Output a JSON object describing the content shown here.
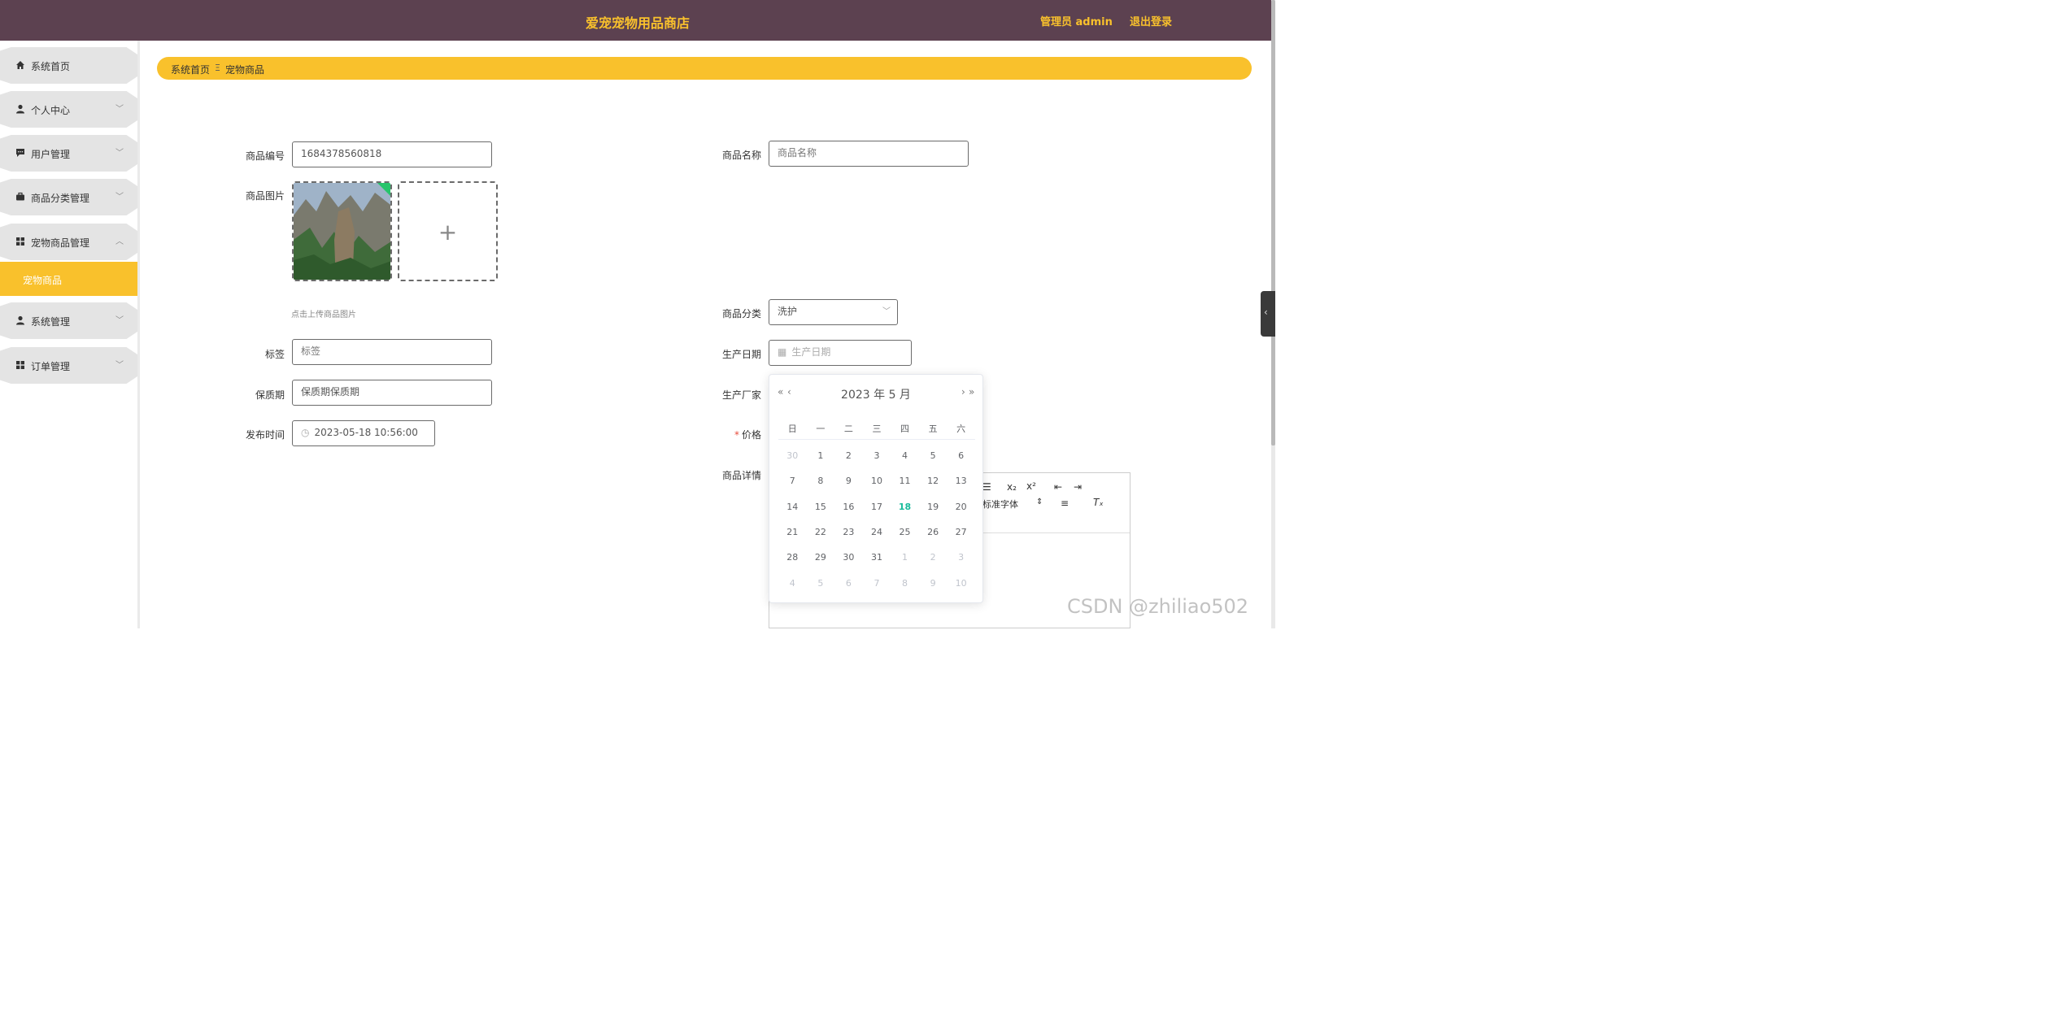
{
  "header": {
    "title": "爱宠宠物用品商店",
    "user": "管理员 admin",
    "logout": "退出登录"
  },
  "sidebar": {
    "items": [
      {
        "label": "系统首页",
        "icon": "home-icon"
      },
      {
        "label": "个人中心",
        "icon": "user-icon"
      },
      {
        "label": "用户管理",
        "icon": "chat-icon"
      },
      {
        "label": "商品分类管理",
        "icon": "briefcase-icon"
      },
      {
        "label": "宠物商品管理",
        "icon": "grid-icon"
      },
      {
        "label": "系统管理",
        "icon": "user-icon"
      },
      {
        "label": "订单管理",
        "icon": "grid-icon"
      }
    ],
    "active_sub": "宠物商品"
  },
  "breadcrumb": {
    "home": "系统首页",
    "separator": "Ξ",
    "current": "宠物商品"
  },
  "form": {
    "code_label": "商品编号",
    "code_value": "1684378560818",
    "name_label": "商品名称",
    "name_placeholder": "商品名称",
    "image_label": "商品图片",
    "image_hint": "点击上传商品图片",
    "category_label": "商品分类",
    "category_value": "洗护",
    "tag_label": "标签",
    "tag_placeholder": "标签",
    "date_label": "生产日期",
    "date_placeholder": "生产日期",
    "shelf_label": "保质期",
    "shelf_value": "保质期保质期",
    "maker_label": "生产厂家",
    "publish_label": "发布时间",
    "publish_value": "2023-05-18 10:56:00",
    "price_label": "价格",
    "price_required": "*",
    "detail_label": "商品详情"
  },
  "editor": {
    "font_select": "标准字体"
  },
  "datepicker": {
    "header": "2023 年  5 月",
    "weekdays": [
      "日",
      "一",
      "二",
      "三",
      "四",
      "五",
      "六"
    ],
    "weeks": [
      [
        "30",
        "1",
        "2",
        "3",
        "4",
        "5",
        "6"
      ],
      [
        "7",
        "8",
        "9",
        "10",
        "11",
        "12",
        "13"
      ],
      [
        "14",
        "15",
        "16",
        "17",
        "18",
        "19",
        "20"
      ],
      [
        "21",
        "22",
        "23",
        "24",
        "25",
        "26",
        "27"
      ],
      [
        "28",
        "29",
        "30",
        "31",
        "1",
        "2",
        "3"
      ],
      [
        "4",
        "5",
        "6",
        "7",
        "8",
        "9",
        "10"
      ]
    ],
    "today": "18"
  },
  "watermark": "CSDN @zhiliao502",
  "colors": {
    "topbar": "#5c4150",
    "accent": "#f9c12c",
    "today": "#1abc9c"
  }
}
